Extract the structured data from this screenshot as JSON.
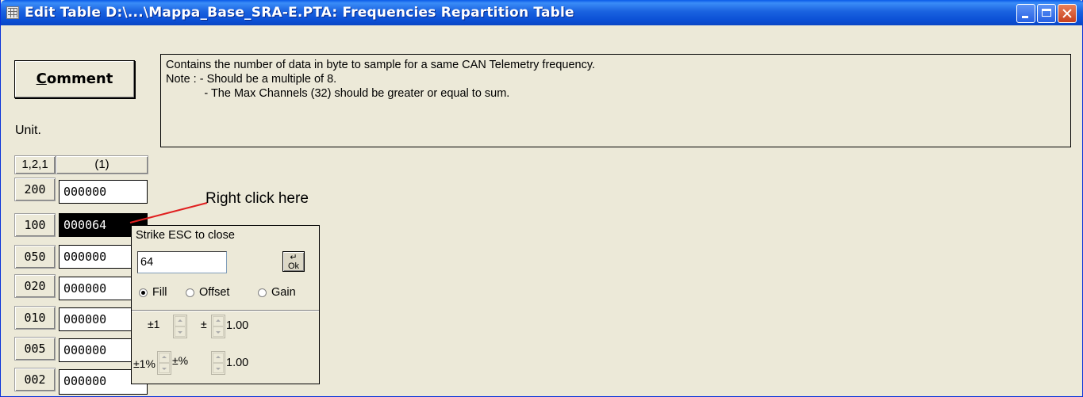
{
  "window": {
    "title": "Edit Table D:\\...\\Mappa_Base_SRA-E.PTA:  Frequencies Repartition Table"
  },
  "comment_button": {
    "label_prefix": "",
    "label_underlined": "C",
    "label_rest": "omment"
  },
  "comment_text": [
    "Contains the number of data in byte to sample for a same CAN Telemetry frequency.",
    "Note : - Should be a multiple of 8.",
    "            - The Max Channels (32) should be greater or equal to sum."
  ],
  "unit_label": "Unit.",
  "table": {
    "axis_header": "1,2,1",
    "column_header": "(1)",
    "rows": [
      {
        "label": "200",
        "value": "000000"
      },
      {
        "label": "100",
        "value": "000064"
      },
      {
        "label": "050",
        "value": "000000"
      },
      {
        "label": "020",
        "value": "000000"
      },
      {
        "label": "010",
        "value": "000000"
      },
      {
        "label": "005",
        "value": "000000"
      },
      {
        "label": "002",
        "value": "000000"
      }
    ],
    "selected_row": "100"
  },
  "annotation": "Right click here",
  "popup": {
    "hint": "Strike ESC to close",
    "value": "64",
    "ok_label": "Ok",
    "modes": [
      {
        "label": "Fill",
        "selected": true
      },
      {
        "label": "Offset",
        "selected": false
      },
      {
        "label": "Gain",
        "selected": false
      }
    ],
    "step_label_1": "±1",
    "step_label_2": "±",
    "step_value_1": "1.00",
    "pct_label_1": "±1%",
    "pct_label_2": "±%",
    "pct_value_1": "1.00"
  },
  "colors": {
    "titlebar": "#0b4fd5",
    "face": "#ece9d8",
    "annotation_line": "#e02020"
  }
}
